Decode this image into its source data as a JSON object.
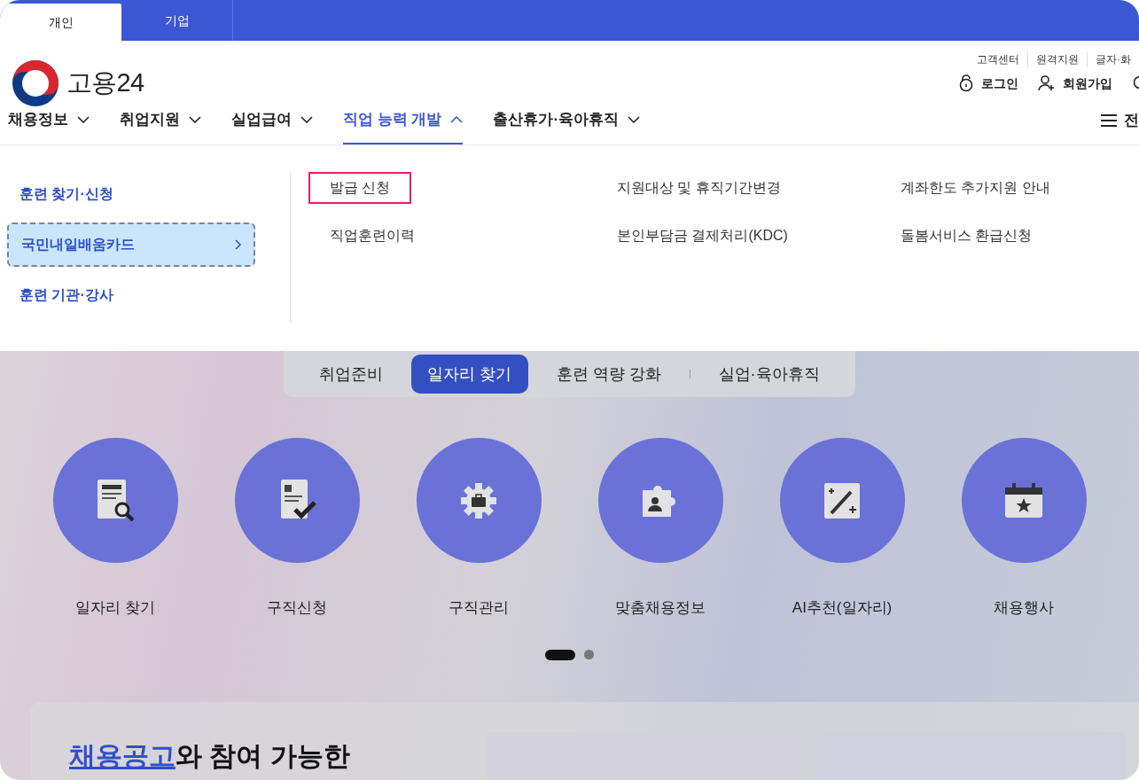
{
  "audience_tabs": [
    {
      "label": "개인",
      "selected": true
    },
    {
      "label": "기업",
      "selected": false
    }
  ],
  "utility_links": [
    "고객센터",
    "원격지원",
    "글자·화"
  ],
  "logo": {
    "text": "고용24"
  },
  "account_links": [
    {
      "kind": "login",
      "label": "로그인"
    },
    {
      "kind": "signup",
      "label": "회원가입"
    }
  ],
  "main_nav": [
    {
      "label": "채용정보",
      "selected": false
    },
    {
      "label": "취업지원",
      "selected": false
    },
    {
      "label": "실업급여",
      "selected": false
    },
    {
      "label": "직업 능력 개발",
      "selected": true
    },
    {
      "label": "출산휴가·육아휴직",
      "selected": false
    }
  ],
  "all_menu": {
    "label": "전"
  },
  "submenu": {
    "categories": [
      {
        "label": "훈련 찾기·신청",
        "selected": false
      },
      {
        "label": "국민내일배움카드",
        "selected": true
      },
      {
        "label": "훈련 기관·강사",
        "selected": false
      }
    ],
    "links": [
      {
        "label": "발급 신청",
        "focused": true
      },
      {
        "label": "지원대상 및 휴직기간변경",
        "focused": false
      },
      {
        "label": "계좌한도 추가지원 안내",
        "focused": false
      },
      {
        "label": "직업훈련이력",
        "focused": false
      },
      {
        "label": "본인부담금 결제처리(KDC)",
        "focused": false
      },
      {
        "label": "돌봄서비스 환급신청",
        "focused": false
      }
    ]
  },
  "segment_tabs": [
    {
      "label": "취업준비",
      "selected": false
    },
    {
      "label": "일자리 찾기",
      "selected": true
    },
    {
      "label": "훈련 역량 강화",
      "selected": false
    },
    {
      "label": "실업·육아휴직",
      "selected": false
    }
  ],
  "services": [
    {
      "kind": "search-doc",
      "label": "일자리 찾기"
    },
    {
      "kind": "check-doc",
      "label": "구직신청"
    },
    {
      "kind": "gear",
      "label": "구직관리"
    },
    {
      "kind": "puzzle",
      "label": "맞춤채용정보"
    },
    {
      "kind": "wand",
      "label": "AI추천(일자리)"
    },
    {
      "kind": "calendar",
      "label": "채용행사"
    }
  ],
  "carousel_dots": [
    {
      "selected": true
    },
    {
      "selected": false
    }
  ],
  "section_heading": {
    "highlight": "채용공고",
    "rest": "와 참여 가능한"
  }
}
